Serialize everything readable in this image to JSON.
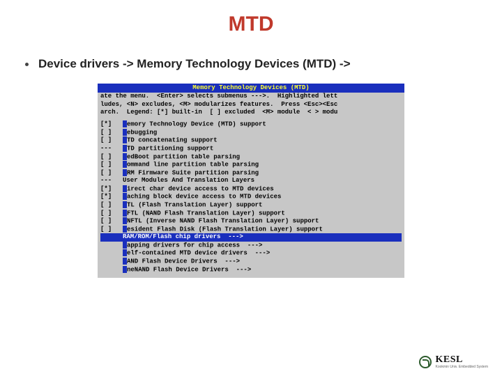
{
  "title": "MTD",
  "bullet": "Device drivers -> Memory Technology Devices (MTD) ->",
  "terminal": {
    "header": "Memory Technology Devices (MTD)",
    "help1": "ate the menu.  <Enter> selects submenus --->.  Highlighted lett",
    "help2": "ludes, <N> excludes, <M> modularizes features.  Press <Esc><Esc",
    "help3": "arch.  Legend: [*] built-in  [ ] excluded  <M> module  < > modu",
    "options": [
      {
        "mark": "[*]",
        "rest": "emory Technology Device (MTD) support",
        "sel": false
      },
      {
        "mark": "[ ]",
        "rest": "ebugging",
        "sel": false
      },
      {
        "mark": "[ ]",
        "rest": "TD concatenating support",
        "sel": false
      },
      {
        "mark": "---",
        "rest": "TD partitioning support",
        "sel": false
      },
      {
        "mark": "[ ]",
        "rest": "edBoot partition table parsing",
        "sel": false
      },
      {
        "mark": "[ ]",
        "rest": "ommand line partition table parsing",
        "sel": false
      },
      {
        "mark": "[ ]",
        "rest": "RM Firmware Suite partition parsing",
        "sel": false
      },
      {
        "mark": "---",
        "rest": "User Modules And Translation Layers",
        "sel": false,
        "nohl": true
      },
      {
        "mark": "[*]",
        "rest": "irect char device access to MTD devices",
        "sel": false
      },
      {
        "mark": "[*]",
        "rest": "aching block device access to MTD devices",
        "sel": false
      },
      {
        "mark": "[ ]",
        "rest": "TL (Flash Translation Layer) support",
        "sel": false
      },
      {
        "mark": "[ ]",
        "rest": "FTL (NAND Flash Translation Layer) support",
        "sel": false
      },
      {
        "mark": "[ ]",
        "rest": "NFTL (Inverse NAND Flash Translation Layer) support",
        "sel": false
      },
      {
        "mark": "[ ]",
        "rest": "esident Flash Disk (Flash Translation Layer) support",
        "sel": false
      },
      {
        "mark": "   ",
        "rest": "RAM/ROM/Flash chip drivers  --->",
        "sel": true,
        "nohl": true
      },
      {
        "mark": "   ",
        "rest": "apping drivers for chip access  --->",
        "sel": false
      },
      {
        "mark": "   ",
        "rest": "elf-contained MTD device drivers  --->",
        "sel": false
      },
      {
        "mark": "   ",
        "rest": "AND Flash Device Drivers  --->",
        "sel": false
      },
      {
        "mark": "   ",
        "rest": "neNAND Flash Device Drivers  --->",
        "sel": false
      }
    ]
  },
  "logo": {
    "text": "KESL",
    "sub": "Kookmin Univ.\nEmbedded System"
  }
}
